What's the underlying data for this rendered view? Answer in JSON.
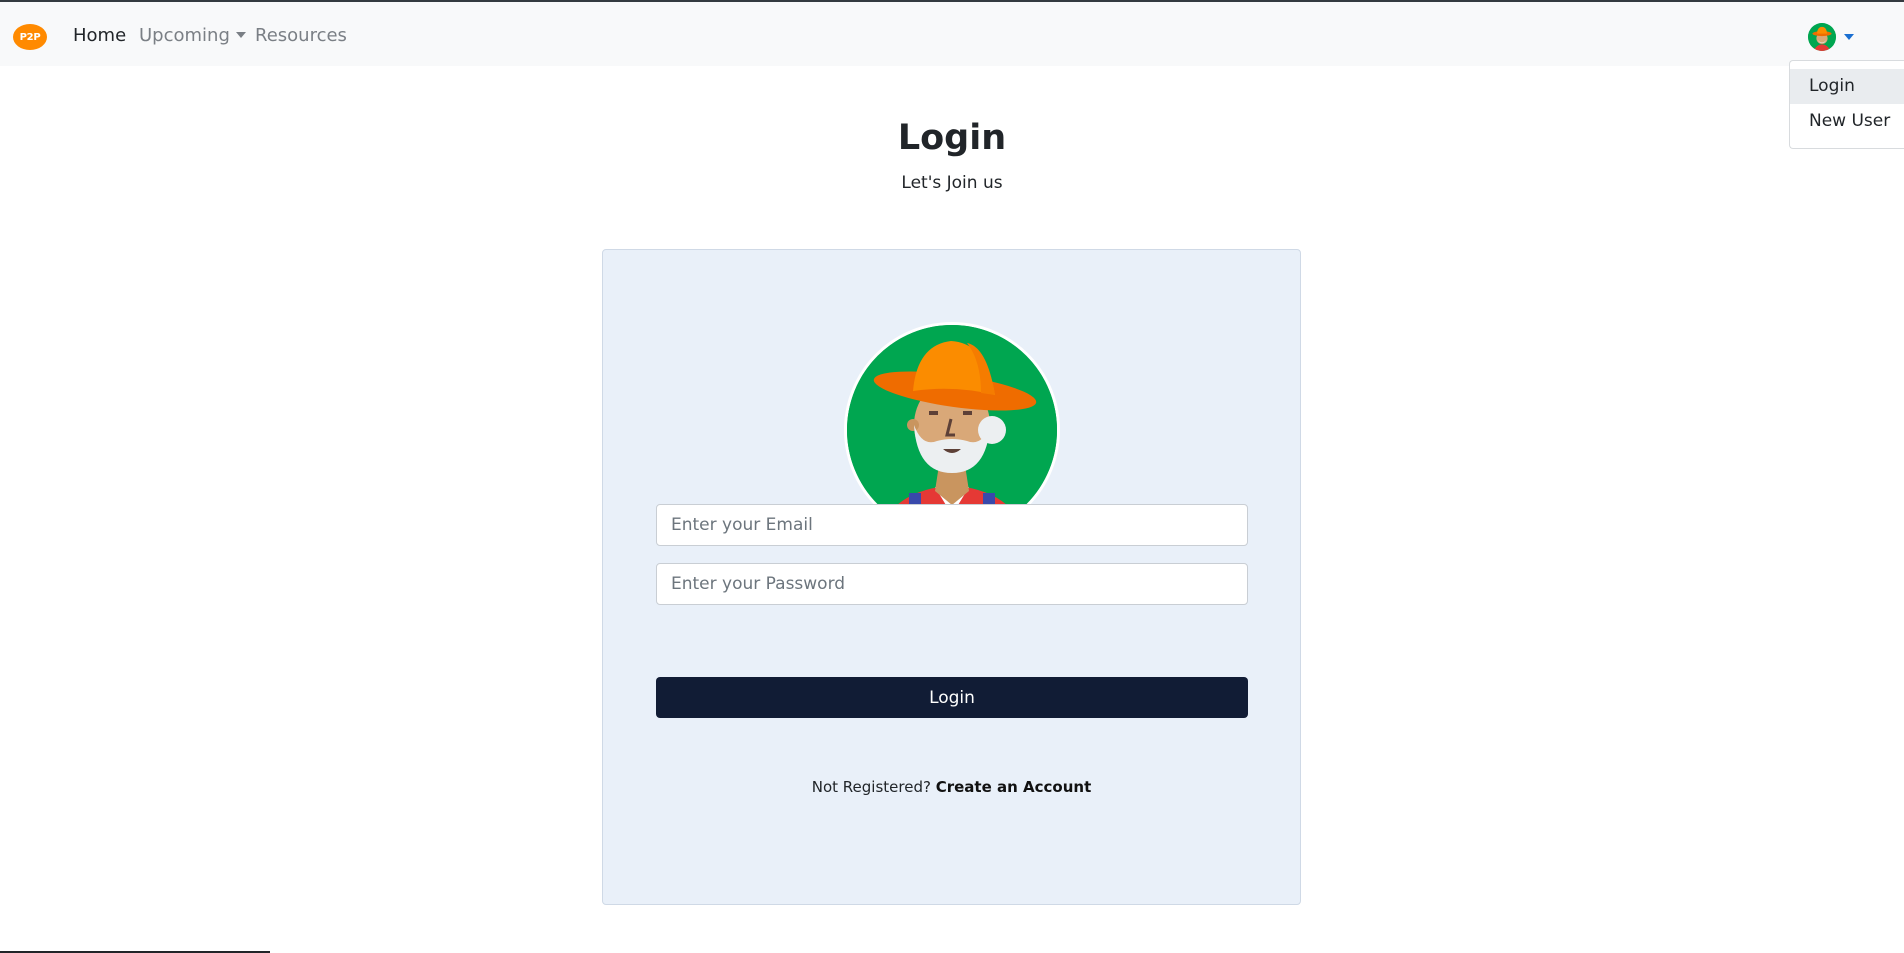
{
  "nav": {
    "brand": "P2P",
    "home": "Home",
    "upcoming": "Upcoming",
    "resources": "Resources"
  },
  "user_menu": {
    "items": [
      "Login",
      "New User"
    ]
  },
  "page": {
    "title": "Login",
    "subtitle": "Let's Join us"
  },
  "form": {
    "email_placeholder": "Enter your Email",
    "password_placeholder": "Enter your Password",
    "submit_label": "Login",
    "register_prompt": "Not Registered?",
    "register_link": "Create an Account"
  },
  "colors": {
    "brand": "#ff8a00",
    "card_bg": "#e9f0f9",
    "button_bg": "#111c35",
    "avatar_bg": "#00a650"
  }
}
